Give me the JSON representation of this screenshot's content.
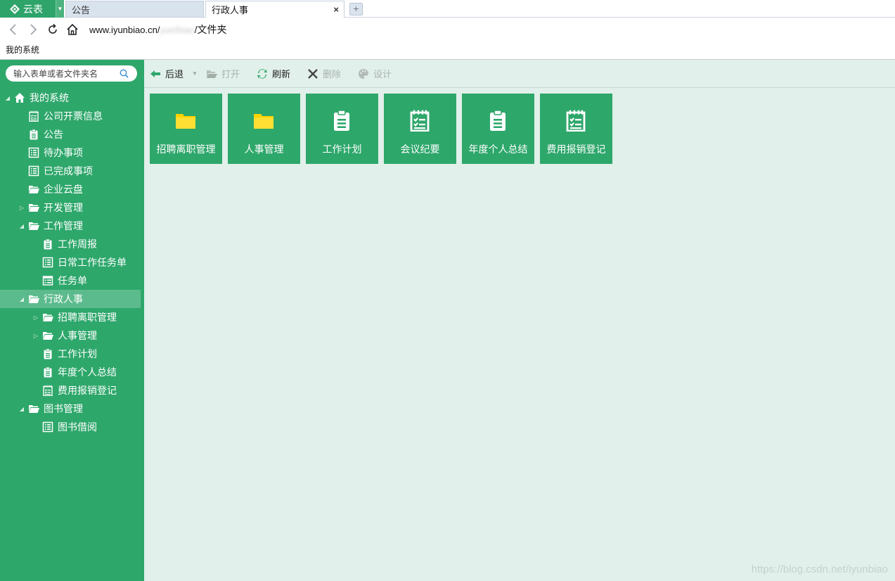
{
  "app": {
    "logo_label": "云表",
    "tabs": [
      {
        "label": "公告",
        "active": false
      },
      {
        "label": "行政人事",
        "active": true
      }
    ],
    "tab_close_glyph": "×",
    "tab_add_glyph": "+"
  },
  "nav": {
    "address_host": "www.iyunbiao.cn/",
    "address_blurred": "yun/biao",
    "address_tail": "/文件夹",
    "bookmark": "我的系统"
  },
  "sidebar": {
    "search_placeholder": "输入表单或者文件夹名",
    "tree": [
      {
        "label": "我的系统",
        "icon": "home-icon",
        "level": 0,
        "twisty": "expanded"
      },
      {
        "label": "公司开票信息",
        "icon": "form-check-icon",
        "level": 1,
        "twisty": "none"
      },
      {
        "label": "公告",
        "icon": "clipboard-icon",
        "level": 1,
        "twisty": "none"
      },
      {
        "label": "待办事项",
        "icon": "list-icon",
        "level": 1,
        "twisty": "none"
      },
      {
        "label": "已完成事项",
        "icon": "list-icon",
        "level": 1,
        "twisty": "none"
      },
      {
        "label": "企业云盘",
        "icon": "folder-icon",
        "level": 1,
        "twisty": "none"
      },
      {
        "label": "开发管理",
        "icon": "folder-icon",
        "level": 1,
        "twisty": "collapsed"
      },
      {
        "label": "工作管理",
        "icon": "folder-icon",
        "level": 1,
        "twisty": "expanded"
      },
      {
        "label": "工作周报",
        "icon": "clipboard-icon",
        "level": 2,
        "twisty": "none"
      },
      {
        "label": "日常工作任务单",
        "icon": "list-icon",
        "level": 2,
        "twisty": "none"
      },
      {
        "label": "任务单",
        "icon": "task-list-icon",
        "level": 2,
        "twisty": "none"
      },
      {
        "label": "行政人事",
        "icon": "folder-icon",
        "level": 1,
        "twisty": "expanded",
        "selected": true
      },
      {
        "label": "招聘离职管理",
        "icon": "folder-icon",
        "level": 2,
        "twisty": "collapsed"
      },
      {
        "label": "人事管理",
        "icon": "folder-icon",
        "level": 2,
        "twisty": "collapsed"
      },
      {
        "label": "工作计划",
        "icon": "clipboard-icon",
        "level": 2,
        "twisty": "none"
      },
      {
        "label": "年度个人总结",
        "icon": "clipboard-icon",
        "level": 2,
        "twisty": "none"
      },
      {
        "label": "费用报销登记",
        "icon": "form-check-icon",
        "level": 2,
        "twisty": "none"
      },
      {
        "label": "图书管理",
        "icon": "folder-icon",
        "level": 1,
        "twisty": "expanded"
      },
      {
        "label": "图书借阅",
        "icon": "list-icon",
        "level": 2,
        "twisty": "none"
      }
    ]
  },
  "toolbar": {
    "back": "后退",
    "open": "打开",
    "refresh": "刷新",
    "delete": "删除",
    "design": "设计"
  },
  "tiles": [
    {
      "label": "招聘离职管理",
      "icon": "folder-icon"
    },
    {
      "label": "人事管理",
      "icon": "folder-icon"
    },
    {
      "label": "工作计划",
      "icon": "clipboard-icon"
    },
    {
      "label": "会议纪要",
      "icon": "form-check-icon"
    },
    {
      "label": "年度个人总结",
      "icon": "clipboard-icon"
    },
    {
      "label": "费用报销登记",
      "icon": "form-check-icon"
    }
  ],
  "watermark": "https://blog.csdn.net/iyunbiao",
  "colors": {
    "brand_green": "#2ea76b",
    "main_bg": "#e1f0ea",
    "folder_yellow": "#ffd200"
  }
}
